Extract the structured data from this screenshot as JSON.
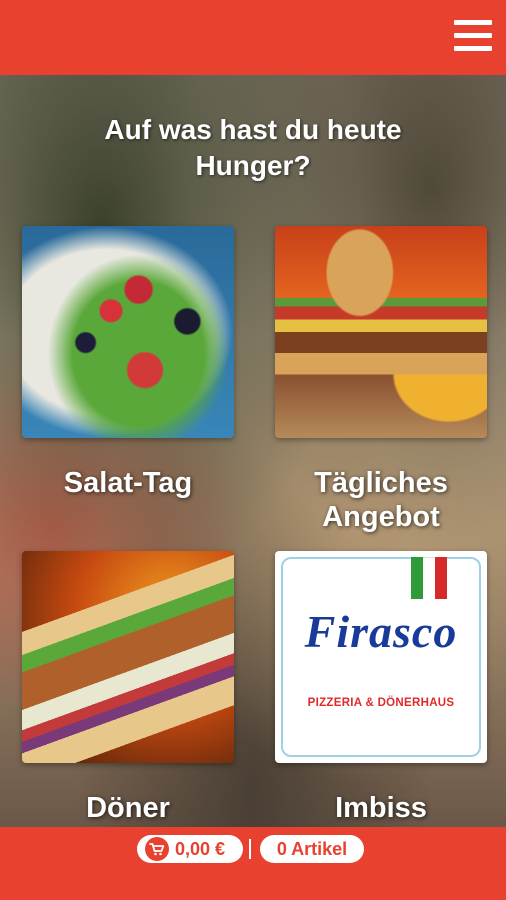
{
  "header": {
    "menu_icon": "hamburger-menu-icon",
    "bar_color": "#e8412f"
  },
  "main": {
    "headline_line1": "Auf was hast du heute",
    "headline_line2": "Hunger?",
    "tiles": [
      {
        "label": "Salat-Tag"
      },
      {
        "label_line1": "Tägliches",
        "label_line2": "Angebot"
      },
      {
        "label": "Döner"
      },
      {
        "label": "Imbiss",
        "logo_word": "Firasco",
        "logo_sub": "PIZZERIA & DÖNERHAUS"
      }
    ]
  },
  "footer": {
    "cart_icon": "shopping-cart-icon",
    "cart_total": "0,00 €",
    "articles": "0 Artikel"
  },
  "colors": {
    "accent": "#e8412f",
    "logo_blue": "#1a3a9a",
    "logo_red": "#e02a2a",
    "flag_green": "#2e9a3a",
    "flag_white": "#ffffff",
    "flag_red": "#d62a2a"
  }
}
